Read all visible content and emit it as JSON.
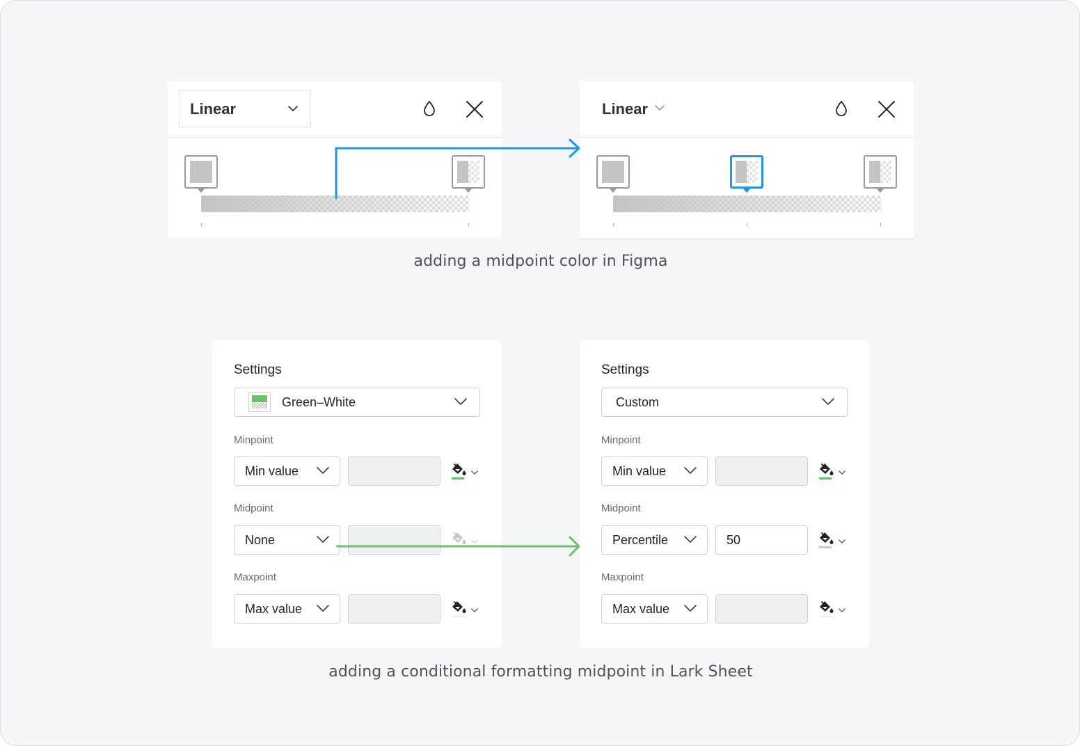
{
  "colors": {
    "figma_arrow": "#1E96EB",
    "lark_arrow": "#6CC06A",
    "minpoint_color": "#6CC06A",
    "midpoint_color": "#C8C8C8",
    "maxpoint_color": "#F0F0F0"
  },
  "figma": {
    "before": {
      "type_select": "Linear",
      "icons": [
        "opacity-drop-icon",
        "close-icon"
      ],
      "stops": [
        {
          "position": 0
        },
        {
          "position": 1
        }
      ]
    },
    "after": {
      "type_label": "Linear",
      "icons": [
        "opacity-drop-icon",
        "close-icon"
      ],
      "stops": [
        {
          "position": 0
        },
        {
          "position": 0.5,
          "selected": true
        },
        {
          "position": 1
        }
      ]
    },
    "caption": "adding a midpoint color in Figma"
  },
  "lark": {
    "before": {
      "title": "Settings",
      "scheme": "Green–White",
      "minpoint": {
        "label": "Minpoint",
        "type": "Min value",
        "value": ""
      },
      "midpoint": {
        "label": "Midpoint",
        "type": "None",
        "value": ""
      },
      "maxpoint": {
        "label": "Maxpoint",
        "type": "Max value",
        "value": ""
      }
    },
    "after": {
      "title": "Settings",
      "scheme": "Custom",
      "minpoint": {
        "label": "Minpoint",
        "type": "Min value",
        "value": ""
      },
      "midpoint": {
        "label": "Midpoint",
        "type": "Percentile",
        "value": "50"
      },
      "maxpoint": {
        "label": "Maxpoint",
        "type": "Max value",
        "value": ""
      }
    },
    "caption": "adding a conditional formatting  midpoint in Lark Sheet"
  }
}
